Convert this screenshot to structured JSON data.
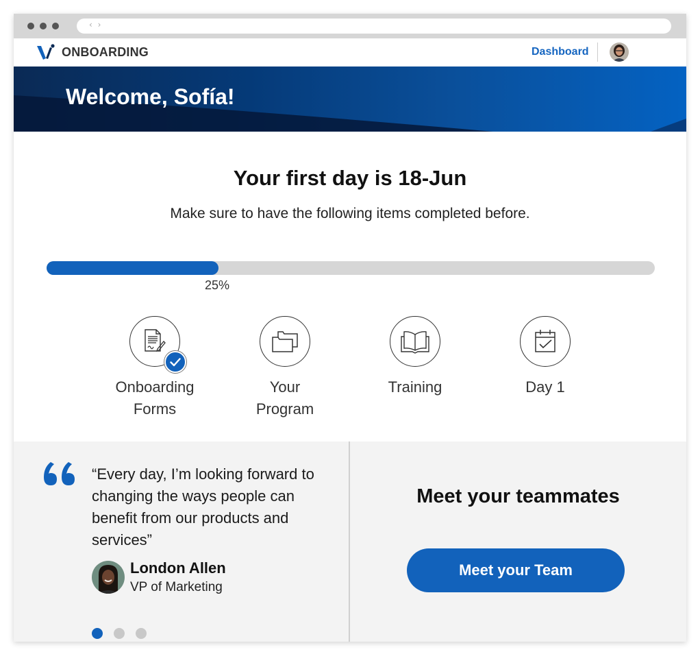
{
  "browser": {
    "nav_arrows": "‹ ›"
  },
  "navbar": {
    "brand": "ONBOARDING",
    "logo_icon": "v-logo-icon",
    "dashboard_link": "Dashboard",
    "user_avatar": "user-avatar"
  },
  "hero": {
    "title": "Welcome, Sofía!"
  },
  "main": {
    "heading": "Your first day is 18-Jun",
    "subheading": "Make sure to have the following items completed before.",
    "progress": {
      "value": 0.25,
      "label": "25%"
    },
    "steps": [
      {
        "label_lines": [
          "Onboarding",
          "Forms"
        ],
        "icon": "document-signature-icon",
        "completed": true
      },
      {
        "label_lines": [
          "Your",
          "Program"
        ],
        "icon": "folders-icon",
        "completed": false
      },
      {
        "label_lines": [
          "Training"
        ],
        "icon": "open-book-icon",
        "completed": false
      },
      {
        "label_lines": [
          "Day 1"
        ],
        "icon": "calendar-check-icon",
        "completed": false
      }
    ]
  },
  "testimonial": {
    "quote": "“Every day, I’m looking forward to changing the ways people can benefit from our products and services”",
    "author_name": "London Allen",
    "author_role": "VP of Marketing",
    "pager": {
      "total": 3,
      "active": 0
    }
  },
  "team": {
    "title": "Meet your teammates",
    "button_label": "Meet your Team"
  },
  "colors": {
    "accent": "#1262bb",
    "link": "#1565c0",
    "track": "#d6d6d6",
    "panel_bg": "#f3f3f3"
  }
}
